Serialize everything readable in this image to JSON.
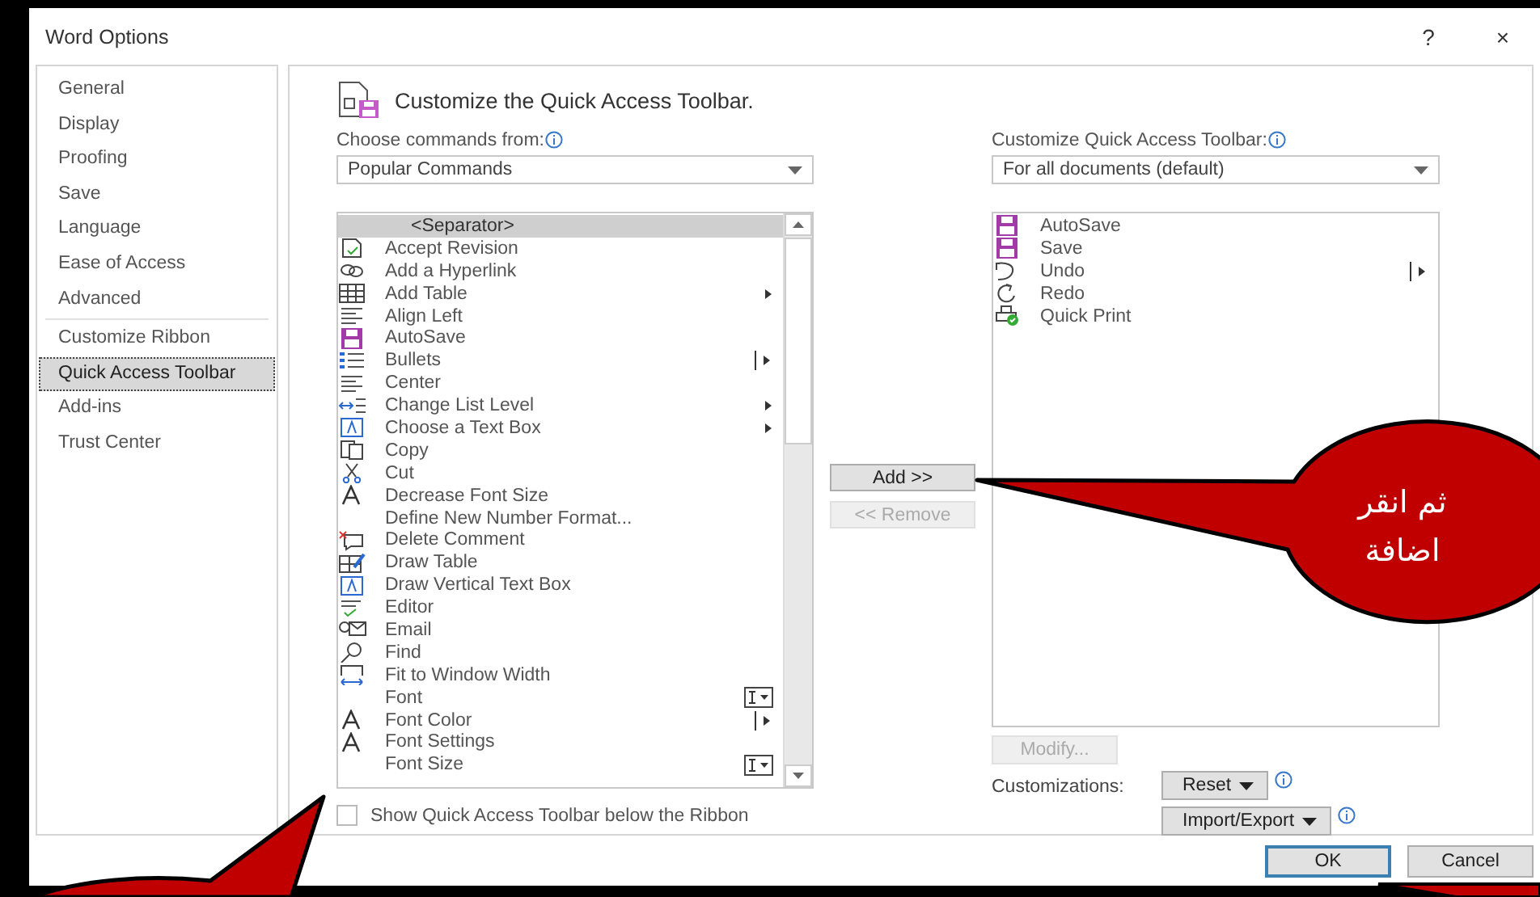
{
  "window": {
    "title": "Word Options",
    "help": "?",
    "close": "×"
  },
  "sidebar": {
    "sections": [
      {
        "items": [
          {
            "label": "General",
            "selected": false
          },
          {
            "label": "Display",
            "selected": false
          },
          {
            "label": "Proofing",
            "selected": false
          },
          {
            "label": "Save",
            "selected": false
          },
          {
            "label": "Language",
            "selected": false
          },
          {
            "label": "Ease of Access",
            "selected": false
          },
          {
            "label": "Advanced",
            "selected": false
          }
        ]
      },
      {
        "items": [
          {
            "label": "Customize Ribbon",
            "selected": false
          },
          {
            "label": "Quick Access Toolbar",
            "selected": true
          },
          {
            "label": "Add-ins",
            "selected": false
          },
          {
            "label": "Trust Center",
            "selected": false
          }
        ]
      }
    ]
  },
  "header": {
    "title": "Customize the Quick Access Toolbar."
  },
  "commands": {
    "label": "Choose commands from:",
    "select": "Popular Commands",
    "items": [
      {
        "label": "<Separator>",
        "selected": true,
        "kind": "plain"
      },
      {
        "label": "Accept Revision",
        "selected": false,
        "kind": "plain"
      },
      {
        "label": "Add a Hyperlink",
        "selected": false,
        "kind": "plain"
      },
      {
        "label": "Add Table",
        "selected": false,
        "kind": "submenu"
      },
      {
        "label": "Align Left",
        "selected": false,
        "kind": "plain"
      },
      {
        "label": "AutoSave",
        "selected": false,
        "kind": "plain"
      },
      {
        "label": "Bullets",
        "selected": false,
        "kind": "split"
      },
      {
        "label": "Center",
        "selected": false,
        "kind": "plain"
      },
      {
        "label": "Change List Level",
        "selected": false,
        "kind": "submenu"
      },
      {
        "label": "Choose a Text Box",
        "selected": false,
        "kind": "submenu"
      },
      {
        "label": "Copy",
        "selected": false,
        "kind": "plain"
      },
      {
        "label": "Cut",
        "selected": false,
        "kind": "plain"
      },
      {
        "label": "Decrease Font Size",
        "selected": false,
        "kind": "plain"
      },
      {
        "label": "Define New Number Format...",
        "selected": false,
        "kind": "plain"
      },
      {
        "label": "Delete Comment",
        "selected": false,
        "kind": "plain"
      },
      {
        "label": "Draw Table",
        "selected": false,
        "kind": "plain"
      },
      {
        "label": "Draw Vertical Text Box",
        "selected": false,
        "kind": "plain"
      },
      {
        "label": "Editor",
        "selected": false,
        "kind": "plain"
      },
      {
        "label": "Email",
        "selected": false,
        "kind": "plain"
      },
      {
        "label": "Find",
        "selected": false,
        "kind": "plain"
      },
      {
        "label": "Fit to Window Width",
        "selected": false,
        "kind": "plain"
      },
      {
        "label": "Font",
        "selected": false,
        "kind": "dropdown"
      },
      {
        "label": "Font Color",
        "selected": false,
        "kind": "split"
      },
      {
        "label": "Font Settings",
        "selected": false,
        "kind": "plain"
      },
      {
        "label": "Font Size",
        "selected": false,
        "kind": "dropdown"
      }
    ]
  },
  "show_below": {
    "label": "Show Quick Access Toolbar below the Ribbon",
    "checked": false
  },
  "transfer_buttons": [
    {
      "label": "Add >>",
      "disabled": false
    },
    {
      "label": "<< Remove",
      "disabled": true
    }
  ],
  "toolbar": {
    "label": "Customize Quick Access Toolbar:",
    "select": "For all documents (default)",
    "items": [
      {
        "label": "AutoSave",
        "selected": false,
        "kind": "plain"
      },
      {
        "label": "Save",
        "selected": false,
        "kind": "plain"
      },
      {
        "label": "Undo",
        "selected": false,
        "kind": "split"
      },
      {
        "label": "Redo",
        "selected": false,
        "kind": "plain"
      },
      {
        "label": "Quick Print",
        "selected": false,
        "kind": "plain"
      }
    ]
  },
  "modify_button": {
    "label": "Modify...",
    "disabled": true
  },
  "customizations": {
    "label": "Customizations:",
    "buttons": [
      "Reset",
      "Import/Export"
    ]
  },
  "footer": [
    {
      "label": "OK",
      "default": true
    },
    {
      "label": "Cancel",
      "default": false
    }
  ],
  "callout": {
    "text": "ثم انقر اضافة"
  }
}
